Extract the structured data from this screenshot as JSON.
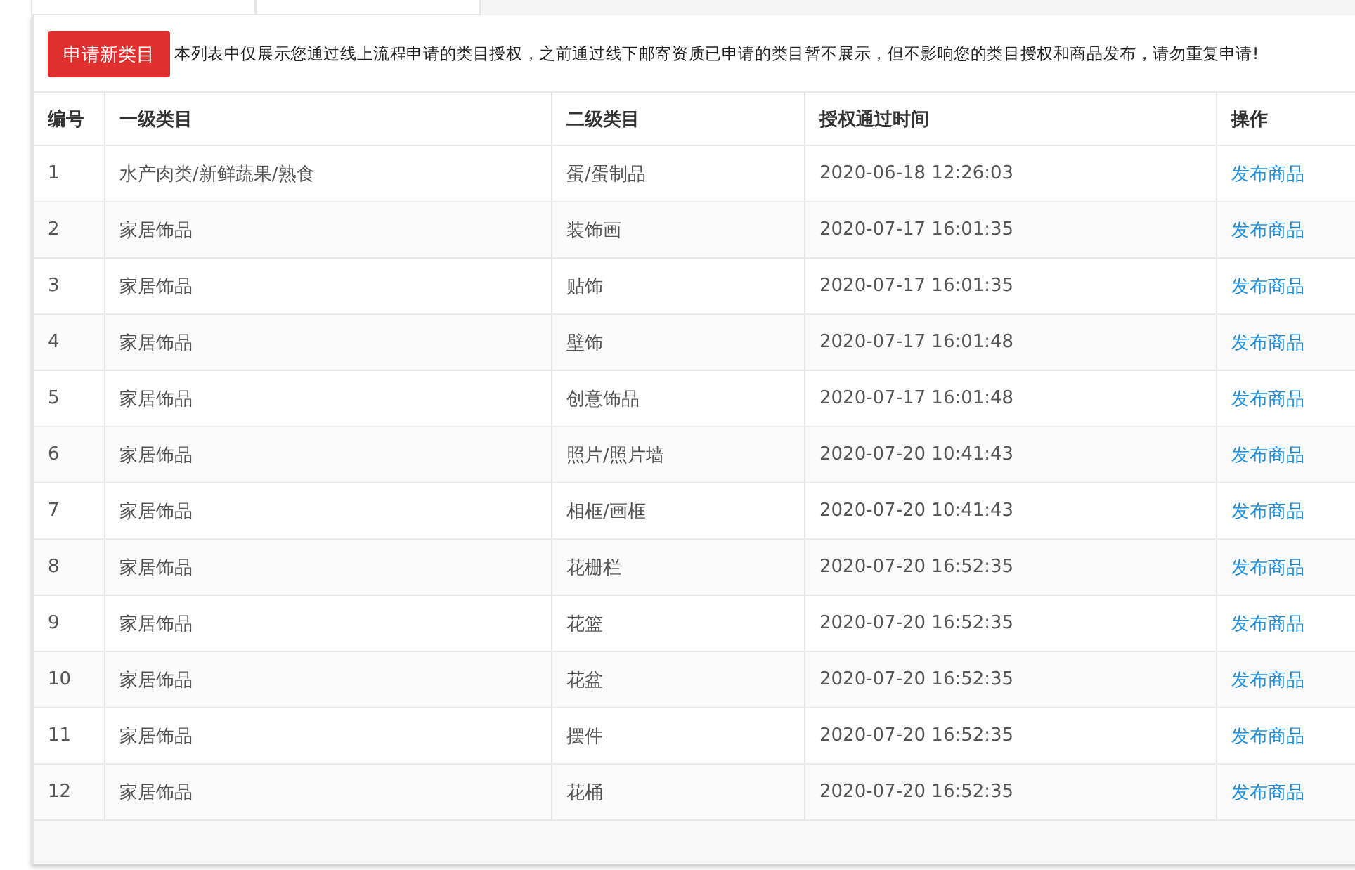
{
  "apply_button": "申请新类目",
  "notice": "本列表中仅展示您通过线上流程申请的类目授权，之前通过线下邮寄资质已申请的类目暂不展示，但不影响您的类目授权和商品发布，请勿重复申请!",
  "table": {
    "columns": [
      "编号",
      "一级类目",
      "二级类目",
      "授权通过时间",
      "操作"
    ],
    "rows": [
      {
        "id": "1",
        "level1": "水产肉类/新鲜蔬果/熟食",
        "level2": "蛋/蛋制品",
        "time": "2020-06-18 12:26:03",
        "action": "发布商品"
      },
      {
        "id": "2",
        "level1": "家居饰品",
        "level2": "装饰画",
        "time": "2020-07-17 16:01:35",
        "action": "发布商品"
      },
      {
        "id": "3",
        "level1": "家居饰品",
        "level2": "贴饰",
        "time": "2020-07-17 16:01:35",
        "action": "发布商品"
      },
      {
        "id": "4",
        "level1": "家居饰品",
        "level2": "壁饰",
        "time": "2020-07-17 16:01:48",
        "action": "发布商品"
      },
      {
        "id": "5",
        "level1": "家居饰品",
        "level2": "创意饰品",
        "time": "2020-07-17 16:01:48",
        "action": "发布商品"
      },
      {
        "id": "6",
        "level1": "家居饰品",
        "level2": "照片/照片墙",
        "time": "2020-07-20 10:41:43",
        "action": "发布商品"
      },
      {
        "id": "7",
        "level1": "家居饰品",
        "level2": "相框/画框",
        "time": "2020-07-20 10:41:43",
        "action": "发布商品"
      },
      {
        "id": "8",
        "level1": "家居饰品",
        "level2": "花栅栏",
        "time": "2020-07-20 16:52:35",
        "action": "发布商品"
      },
      {
        "id": "9",
        "level1": "家居饰品",
        "level2": "花篮",
        "time": "2020-07-20 16:52:35",
        "action": "发布商品"
      },
      {
        "id": "10",
        "level1": "家居饰品",
        "level2": "花盆",
        "time": "2020-07-20 16:52:35",
        "action": "发布商品"
      },
      {
        "id": "11",
        "level1": "家居饰品",
        "level2": "摆件",
        "time": "2020-07-20 16:52:35",
        "action": "发布商品"
      },
      {
        "id": "12",
        "level1": "家居饰品",
        "level2": "花桶",
        "time": "2020-07-20 16:52:35",
        "action": "发布商品"
      }
    ]
  }
}
